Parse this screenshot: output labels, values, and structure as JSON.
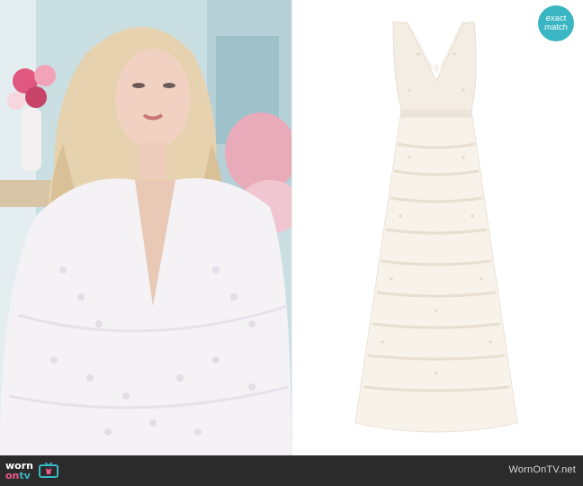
{
  "badge": {
    "line1": "exact",
    "line2": "match",
    "color": "#3ab6c3"
  },
  "footer": {
    "logo": {
      "worn": "worn",
      "on": "on",
      "tv": "tv",
      "icon": "tv-icon"
    },
    "site": "WornOnTV.net",
    "background": "#2b2b2b"
  },
  "images": {
    "left": "woman-in-white-lace-cape-and-gown",
    "right": "white-tiered-tulle-v-neck-gown"
  },
  "colors": {
    "accent_pink": "#ef5b8c",
    "accent_teal": "#3ab6c3"
  }
}
